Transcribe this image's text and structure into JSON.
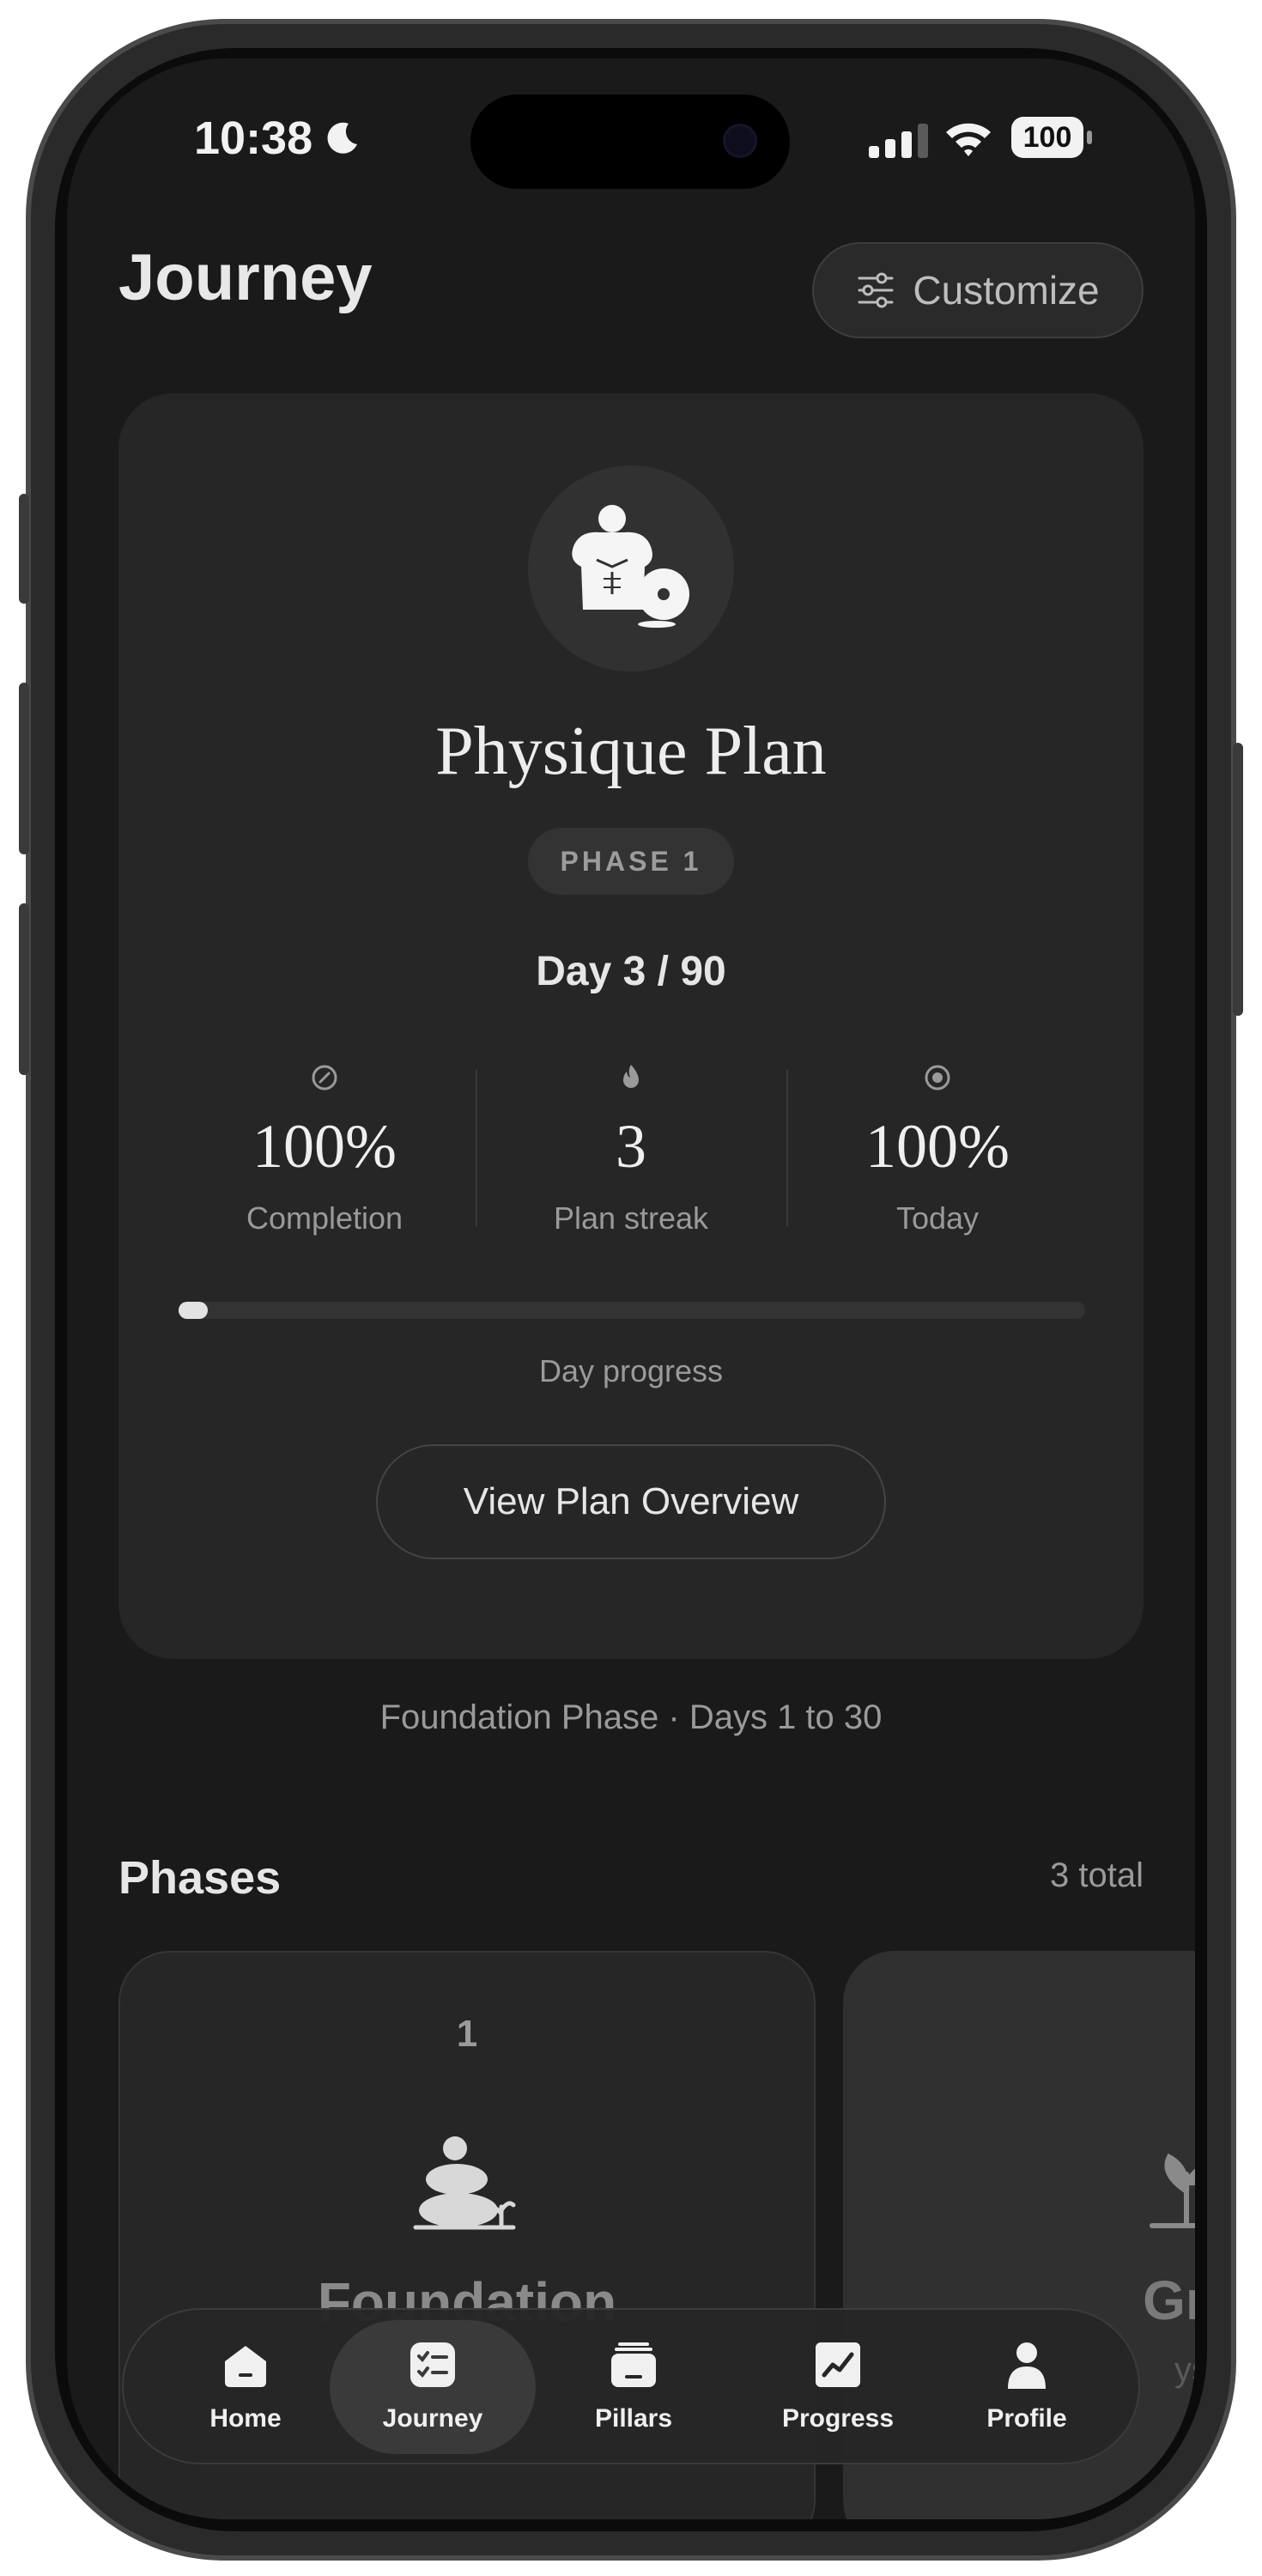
{
  "status_bar": {
    "time": "10:38",
    "battery": "100"
  },
  "header": {
    "title": "Journey",
    "customize_label": "Customize"
  },
  "plan": {
    "title": "Physique Plan",
    "phase_badge": "PHASE 1",
    "day_text": "Day 3 / 90",
    "stats": [
      {
        "icon": "target-icon",
        "value": "100%",
        "label": "Completion"
      },
      {
        "icon": "flame-icon",
        "value": "3",
        "label": "Plan streak"
      },
      {
        "icon": "radio-dot-icon",
        "value": "100%",
        "label": "Today"
      }
    ],
    "day_progress_fraction": 0.03,
    "progress_label": "Day progress",
    "overview_button": "View Plan Overview"
  },
  "phase_caption": "Foundation Phase · Days 1 to 30",
  "phases": {
    "title": "Phases",
    "total": "3 total",
    "items": [
      {
        "number": "1",
        "name": "Foundation",
        "icon": "stacked-stones-icon"
      },
      {
        "name": "Gro",
        "sub": "ys",
        "icon": "sprout-icon"
      }
    ]
  },
  "tabs": [
    {
      "label": "Home",
      "icon": "home-icon",
      "active": false
    },
    {
      "label": "Journey",
      "icon": "checklist-icon",
      "active": true
    },
    {
      "label": "Pillars",
      "icon": "pillars-icon",
      "active": false
    },
    {
      "label": "Progress",
      "icon": "chart-line-icon",
      "active": false
    },
    {
      "label": "Profile",
      "icon": "person-icon",
      "active": false
    }
  ],
  "colors": {
    "background": "#1a1a1a",
    "card": "#262626",
    "text": "#e6e6e6",
    "muted": "#9a9a9a"
  }
}
